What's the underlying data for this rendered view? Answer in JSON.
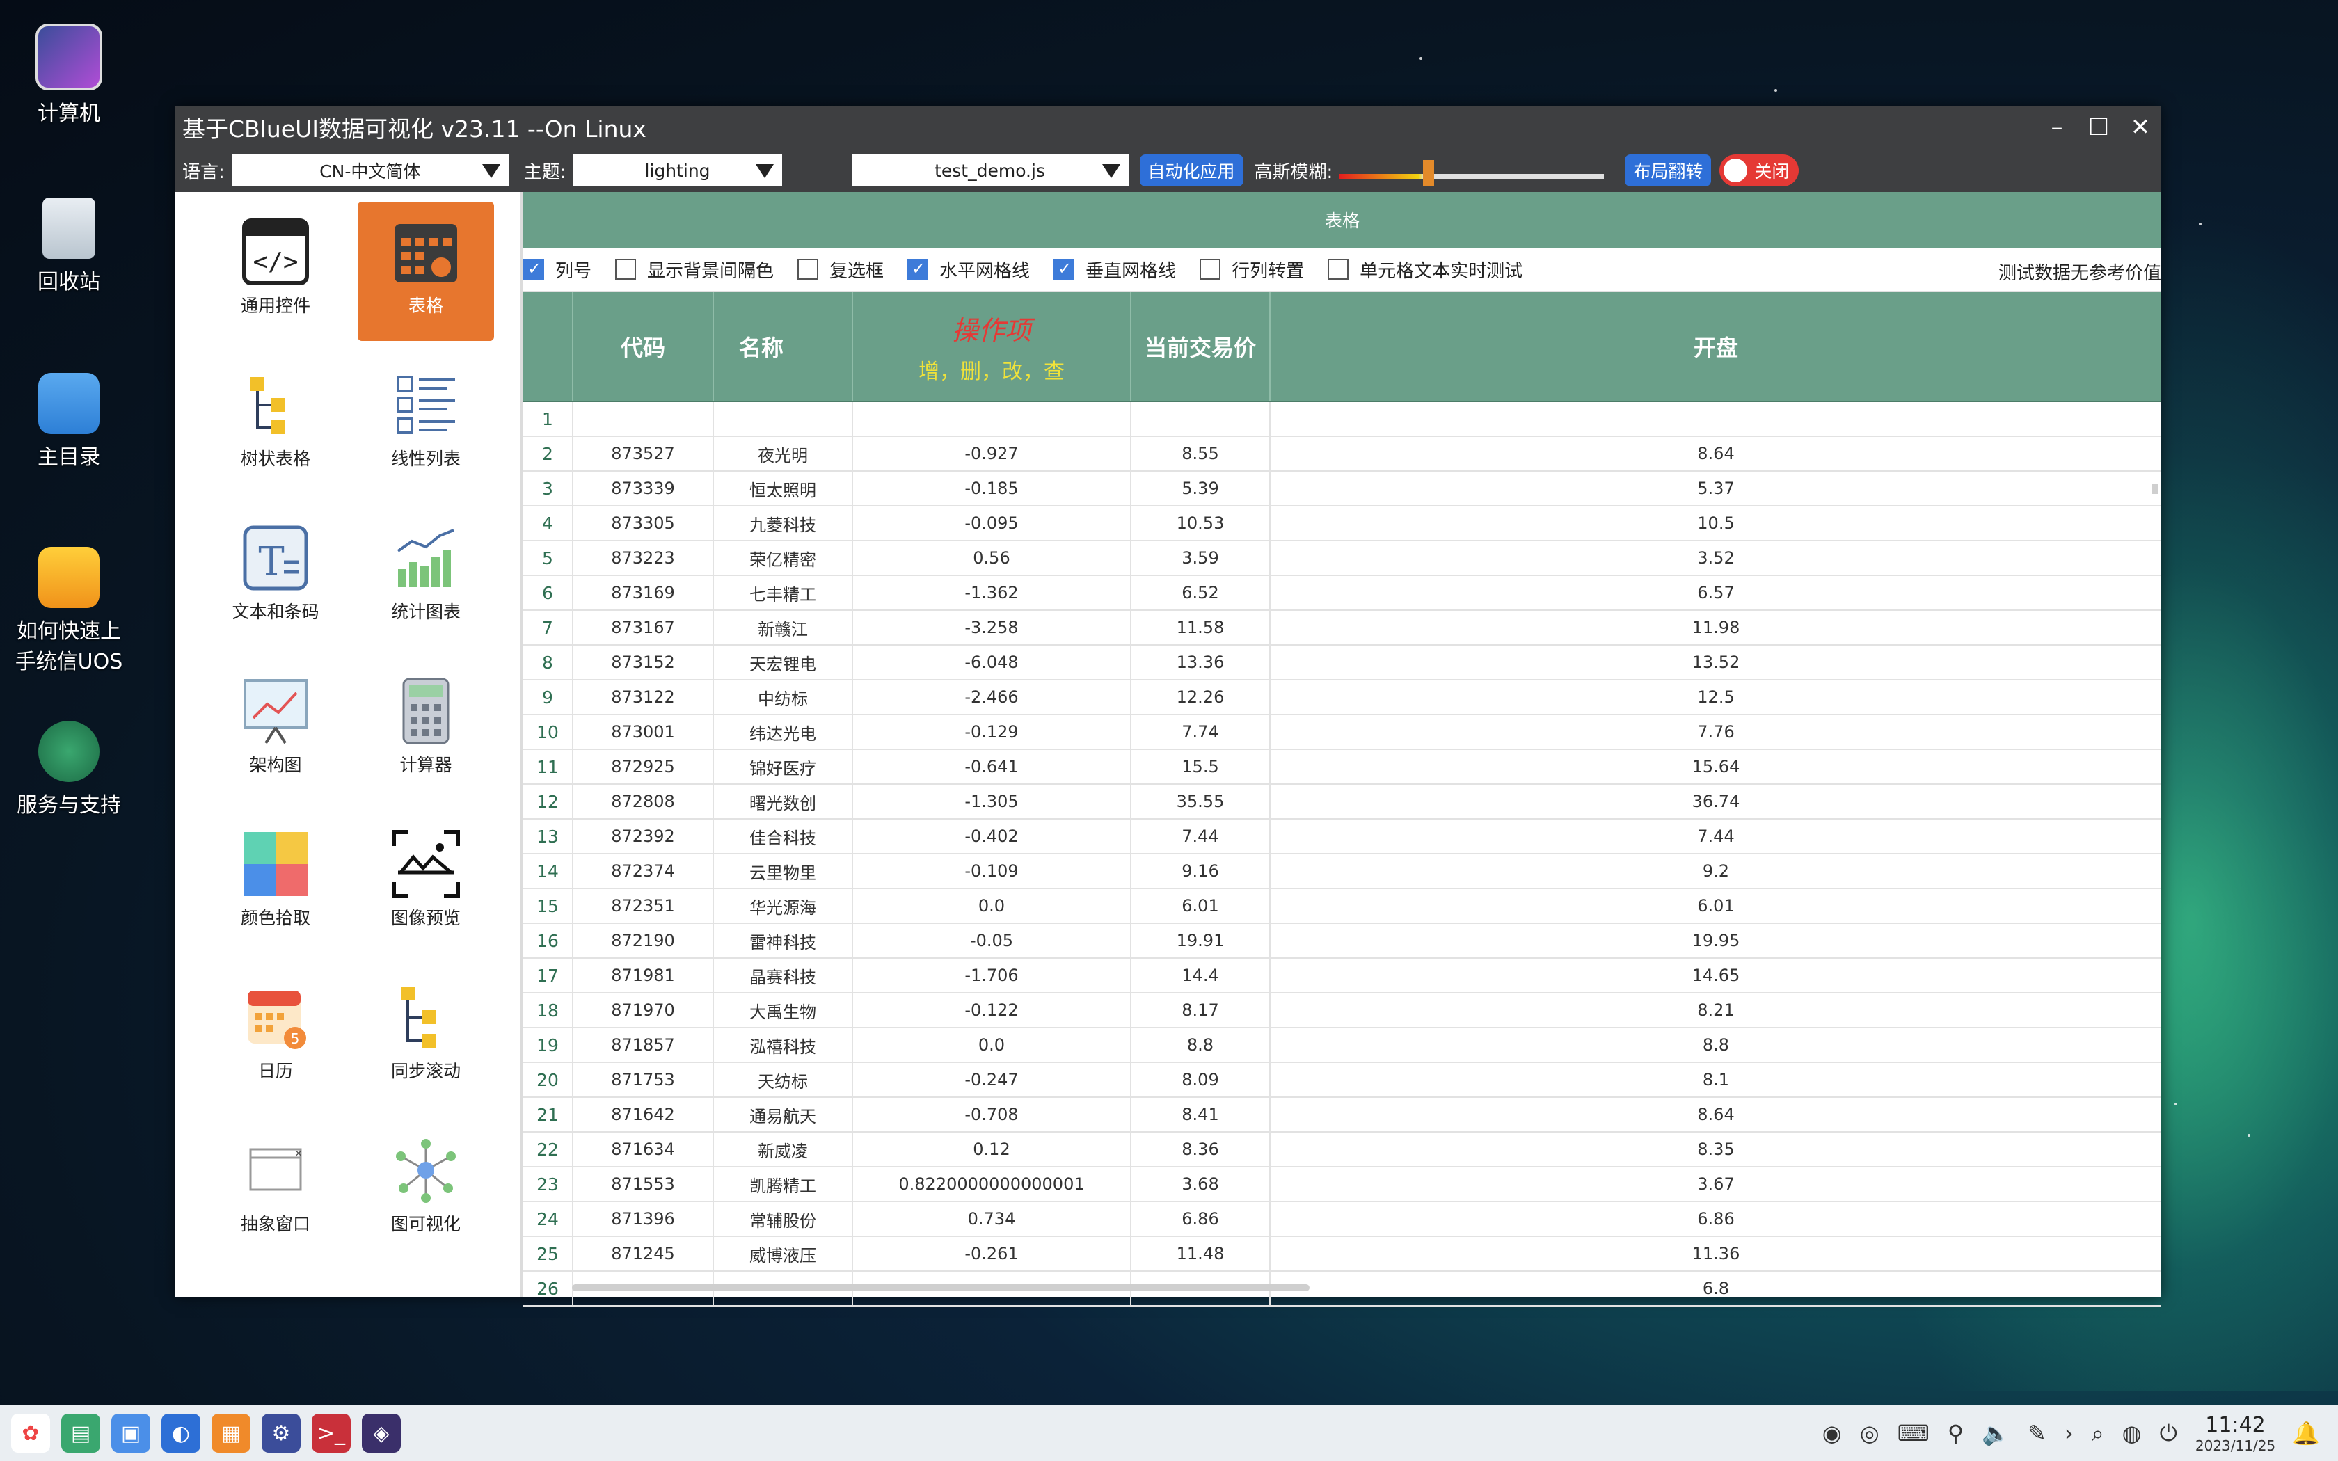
{
  "desktop": {
    "icons": [
      {
        "label": "计算机"
      },
      {
        "label": "回收站"
      },
      {
        "label": "主目录"
      },
      {
        "label": "如何快速上手统信UOS"
      },
      {
        "label": "服务与支持"
      }
    ]
  },
  "window": {
    "title": "基于CBlueUI数据可视化 v23.11 --On Linux",
    "toolbar": {
      "language_label": "语言:",
      "language_value": "CN-中文简体",
      "theme_label": "主题:",
      "theme_value": "lighting",
      "script_value": "test_demo.js",
      "auto_apply_label": "自动化应用",
      "blur_label": "高斯模糊:",
      "blur_level": 0.33,
      "flip_layout_label": "布局翻转",
      "toggle_label": "关闭"
    },
    "sidebar": {
      "items": [
        {
          "label": "通用控件"
        },
        {
          "label": "表格"
        },
        {
          "label": "树状表格"
        },
        {
          "label": "线性列表"
        },
        {
          "label": "文本和条码"
        },
        {
          "label": "统计图表"
        },
        {
          "label": "架构图"
        },
        {
          "label": "计算器"
        },
        {
          "label": "颜色拾取"
        },
        {
          "label": "图像预览"
        },
        {
          "label": "日历"
        },
        {
          "label": "同步滚动"
        },
        {
          "label": "抽象窗口"
        },
        {
          "label": "图可视化"
        }
      ],
      "active_index": 1
    },
    "content": {
      "title": "表格",
      "options": [
        {
          "label": "列号",
          "checked": true
        },
        {
          "label": "显示背景间隔色",
          "checked": false
        },
        {
          "label": "复选框",
          "checked": false
        },
        {
          "label": "水平网格线",
          "checked": true
        },
        {
          "label": "垂直网格线",
          "checked": true
        },
        {
          "label": "行列转置",
          "checked": false
        },
        {
          "label": "单元格文本实时测试",
          "checked": false
        }
      ],
      "note": "测试数据无参考价值",
      "table": {
        "headers": {
          "code": "代码",
          "name": "名称",
          "op_title": "操作项",
          "op_sub": "增，删，改，查",
          "price": "当前交易价",
          "open": "开盘"
        },
        "rows": [
          [
            "1",
            "",
            "",
            "",
            "",
            ""
          ],
          [
            "2",
            "873527",
            "夜光明",
            "-0.927",
            "8.55",
            "8.64"
          ],
          [
            "3",
            "873339",
            "恒太照明",
            "-0.185",
            "5.39",
            "5.37"
          ],
          [
            "4",
            "873305",
            "九菱科技",
            "-0.095",
            "10.53",
            "10.5"
          ],
          [
            "5",
            "873223",
            "荣亿精密",
            "0.56",
            "3.59",
            "3.52"
          ],
          [
            "6",
            "873169",
            "七丰精工",
            "-1.362",
            "6.52",
            "6.57"
          ],
          [
            "7",
            "873167",
            "新赣江",
            "-3.258",
            "11.58",
            "11.98"
          ],
          [
            "8",
            "873152",
            "天宏锂电",
            "-6.048",
            "13.36",
            "13.52"
          ],
          [
            "9",
            "873122",
            "中纺标",
            "-2.466",
            "12.26",
            "12.5"
          ],
          [
            "10",
            "873001",
            "纬达光电",
            "-0.129",
            "7.74",
            "7.76"
          ],
          [
            "11",
            "872925",
            "锦好医疗",
            "-0.641",
            "15.5",
            "15.64"
          ],
          [
            "12",
            "872808",
            "曙光数创",
            "-1.305",
            "35.55",
            "36.74"
          ],
          [
            "13",
            "872392",
            "佳合科技",
            "-0.402",
            "7.44",
            "7.44"
          ],
          [
            "14",
            "872374",
            "云里物里",
            "-0.109",
            "9.16",
            "9.2"
          ],
          [
            "15",
            "872351",
            "华光源海",
            "0.0",
            "6.01",
            "6.01"
          ],
          [
            "16",
            "872190",
            "雷神科技",
            "-0.05",
            "19.91",
            "19.95"
          ],
          [
            "17",
            "871981",
            "晶赛科技",
            "-1.706",
            "14.4",
            "14.65"
          ],
          [
            "18",
            "871970",
            "大禹生物",
            "-0.122",
            "8.17",
            "8.21"
          ],
          [
            "19",
            "871857",
            "泓禧科技",
            "0.0",
            "8.8",
            "8.8"
          ],
          [
            "20",
            "871753",
            "天纺标",
            "-0.247",
            "8.09",
            "8.1"
          ],
          [
            "21",
            "871642",
            "通易航天",
            "-0.708",
            "8.41",
            "8.64"
          ],
          [
            "22",
            "871634",
            "新威凌",
            "0.12",
            "8.36",
            "8.35"
          ],
          [
            "23",
            "871553",
            "凯腾精工",
            "0.8220000000000001",
            "3.68",
            "3.67"
          ],
          [
            "24",
            "871396",
            "常辅股份",
            "0.734",
            "6.86",
            "6.86"
          ],
          [
            "25",
            "871245",
            "威博液压",
            "-0.261",
            "11.48",
            "11.36"
          ],
          [
            "26",
            "",
            "",
            "",
            "",
            "6.8"
          ]
        ]
      }
    }
  },
  "taskbar": {
    "time": "11:42",
    "date": "2023/11/25"
  },
  "colors": {
    "accent_green": "#6a9f89",
    "active_orange": "#e7762e",
    "blue_button": "#2e6fd8",
    "toggle_red": "#e53935"
  }
}
